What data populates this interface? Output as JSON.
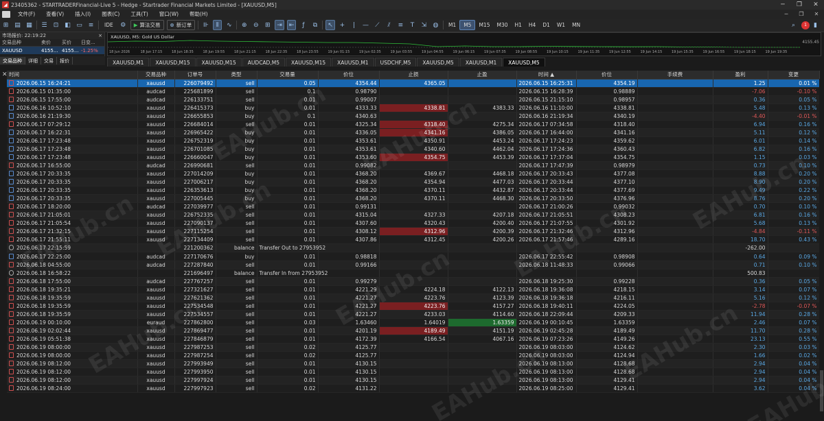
{
  "window": {
    "title": "23405362 - STARTRADERFinancial-Live 5 - Hedge - Startrader Financial Markets Limited - [XAUUSD,M5]",
    "minimize": "─",
    "restore": "❐",
    "close": "✕"
  },
  "menu": [
    "文件(F)",
    "查看(V)",
    "插入(I)",
    "图表(C)",
    "工具(T)",
    "窗口(W)",
    "帮助(H)"
  ],
  "menu_controls": [
    "─",
    "❐",
    "✕"
  ],
  "toolbar": {
    "algo_trading": "算法交易",
    "new_order": "新订单",
    "ide": "IDE",
    "timeframes": [
      "M1",
      "M5",
      "M15",
      "M30",
      "H1",
      "H4",
      "D1",
      "W1",
      "MN"
    ],
    "active_timeframe": "M5",
    "notification_count": "1"
  },
  "market_watch": {
    "title": "市场报价: 22:19:22",
    "close": "×",
    "cols": [
      "交易品种",
      "卖价",
      "买价",
      "日变..."
    ],
    "row": {
      "symbol": "XAUUSD",
      "bid": "4155...",
      "ask": "4155...",
      "change": "-1.25%"
    },
    "tabs": [
      "交易品种",
      "详细",
      "交易",
      "报价"
    ]
  },
  "chart": {
    "title": "XAUUSD, M5: Gold US Dollar",
    "price_label": "4155.45",
    "xaxis": [
      "18 Jun 2026",
      "18 Jun 17:15",
      "18 Jun 18:35",
      "18 Jun 19:55",
      "18 Jun 21:15",
      "18 Jun 22:35",
      "18 Jun 23:55",
      "19 Jun 01:15",
      "19 Jun 02:35",
      "19 Jun 03:55",
      "19 Jun 04:55",
      "19 Jun 06:15",
      "19 Jun 07:35",
      "19 Jun 08:55",
      "19 Jun 10:15",
      "19 Jun 11:35",
      "19 Jun 12:55",
      "19 Jun 14:15",
      "19 Jun 15:35",
      "19 Jun 16:55",
      "19 Jun 18:15",
      "19 Jun 19:35"
    ]
  },
  "chart_tabs": [
    "XAUUSD,M1",
    "XAUUSD,M15",
    "XAUUSD,M15",
    "AUDCAD,M5",
    "XAUUSD,M15",
    "XAUUSD,M1",
    "USDCHF,M5",
    "XAUUSD,M5",
    "XAUUSD,M1",
    "XAUUSD,M5"
  ],
  "active_chart_tab": 9,
  "watermark": "EAHub.cn",
  "columns": [
    "时间",
    "交易品种",
    "订单号",
    "类型",
    "交易量",
    "价位",
    "止损",
    "止盈",
    "时间 ▲",
    "价位",
    "手续费",
    "盈利",
    "变更"
  ],
  "rows": [
    {
      "t": "2026.06.15 16:24:21",
      "s": "xauusd",
      "id": "226079492",
      "ty": "sell",
      "v": "0.05",
      "p": "4354.44",
      "sl": "4365.05",
      "tp": "",
      "t2": "2026.06.15 16:25:31",
      "p2": "4354.19",
      "pr": "1.25",
      "ch": "0.01 %",
      "sel": true
    },
    {
      "t": "2026.06.15 01:35:00",
      "s": "audcad",
      "id": "225681899",
      "ty": "sell",
      "v": "0.1",
      "p": "0.98790",
      "sl": "",
      "tp": "",
      "t2": "2026.06.15 16:28:39",
      "p2": "0.98889",
      "pr": "-7.06",
      "ch": "-0.10 %"
    },
    {
      "t": "2026.06.15 17:55:00",
      "s": "audcad",
      "id": "226133751",
      "ty": "sell",
      "v": "0.01",
      "p": "0.99007",
      "sl": "",
      "tp": "",
      "t2": "2026.06.15 21:15:10",
      "p2": "0.98957",
      "pr": "0.36",
      "ch": "0.05 %"
    },
    {
      "t": "2026.06.16 10:52:10",
      "s": "xauusd",
      "id": "226415373",
      "ty": "buy",
      "v": "0.01",
      "p": "4333.33",
      "sl": "4338.81",
      "tp": "4383.33",
      "t2": "2026.06.16 11:10:00",
      "p2": "4338.81",
      "pr": "5.48",
      "ch": "0.13 %",
      "slHit": true
    },
    {
      "t": "2026.06.16 21:19:30",
      "s": "xauusd",
      "id": "226655853",
      "ty": "buy",
      "v": "0.1",
      "p": "4340.63",
      "sl": "",
      "tp": "",
      "t2": "2026.06.16 21:19:34",
      "p2": "4340.19",
      "pr": "-4.40",
      "ch": "-0.01 %"
    },
    {
      "t": "2026.06.17 07:29:12",
      "s": "xauusd",
      "id": "226684014",
      "ty": "sell",
      "v": "0.01",
      "p": "4325.34",
      "sl": "4318.40",
      "tp": "4275.34",
      "t2": "2026.06.17 07:34:58",
      "p2": "4318.40",
      "pr": "6.94",
      "ch": "0.16 %",
      "slHit": true
    },
    {
      "t": "2026.06.17 16:22:31",
      "s": "xauusd",
      "id": "226965422",
      "ty": "buy",
      "v": "0.01",
      "p": "4336.05",
      "sl": "4341.16",
      "tp": "4386.05",
      "t2": "2026.06.17 16:44:00",
      "p2": "4341.16",
      "pr": "5.11",
      "ch": "0.12 %",
      "slHit": true
    },
    {
      "t": "2026.06.17 17:23:48",
      "s": "xauusd",
      "id": "226752319",
      "ty": "buy",
      "v": "0.01",
      "p": "4353.61",
      "sl": "4350.91",
      "tp": "4453.24",
      "t2": "2026.06.17 17:24:23",
      "p2": "4359.62",
      "pr": "6.01",
      "ch": "0.14 %"
    },
    {
      "t": "2026.06.17 17:23:48",
      "s": "xauusd",
      "id": "226701085",
      "ty": "buy",
      "v": "0.01",
      "p": "4353.61",
      "sl": "4340.60",
      "tp": "4462.04",
      "t2": "2026.06.17 17:24:36",
      "p2": "4360.43",
      "pr": "6.82",
      "ch": "0.16 %"
    },
    {
      "t": "2026.06.17 17:23:48",
      "s": "xauusd",
      "id": "226660047",
      "ty": "buy",
      "v": "0.01",
      "p": "4353.60",
      "sl": "4354.75",
      "tp": "4453.39",
      "t2": "2026.06.17 17:37:04",
      "p2": "4354.75",
      "pr": "1.15",
      "ch": "0.03 %",
      "slHit": true
    },
    {
      "t": "2026.06.17 16:55:00",
      "s": "audcad",
      "id": "226990681",
      "ty": "sell",
      "v": "0.01",
      "p": "0.99082",
      "sl": "",
      "tp": "",
      "t2": "2026.06.17 17:47:39",
      "p2": "0.98979",
      "pr": "0.73",
      "ch": "0.10 %"
    },
    {
      "t": "2026.06.17 20:33:35",
      "s": "xauusd",
      "id": "227014209",
      "ty": "buy",
      "v": "0.01",
      "p": "4368.20",
      "sl": "4369.67",
      "tp": "4468.18",
      "t2": "2026.06.17 20:33:43",
      "p2": "4377.08",
      "pr": "8.88",
      "ch": "0.20 %"
    },
    {
      "t": "2026.06.17 20:33:35",
      "s": "xauusd",
      "id": "227006217",
      "ty": "buy",
      "v": "0.01",
      "p": "4368.20",
      "sl": "4354.94",
      "tp": "4477.03",
      "t2": "2026.06.17 20:33:44",
      "p2": "4377.10",
      "pr": "8.90",
      "ch": "0.20 %"
    },
    {
      "t": "2026.06.17 20:33:35",
      "s": "xauusd",
      "id": "226353613",
      "ty": "buy",
      "v": "0.01",
      "p": "4368.20",
      "sl": "4370.11",
      "tp": "4432.87",
      "t2": "2026.06.17 20:33:44",
      "p2": "4377.69",
      "pr": "9.49",
      "ch": "0.22 %"
    },
    {
      "t": "2026.06.17 20:33:35",
      "s": "xauusd",
      "id": "227005445",
      "ty": "buy",
      "v": "0.01",
      "p": "4368.20",
      "sl": "4370.11",
      "tp": "4468.30",
      "t2": "2026.06.17 20:33:50",
      "p2": "4376.96",
      "pr": "8.76",
      "ch": "0.20 %"
    },
    {
      "t": "2026.06.17 18:20:00",
      "s": "audcad",
      "id": "227039977",
      "ty": "sell",
      "v": "0.01",
      "p": "0.99131",
      "sl": "",
      "tp": "",
      "t2": "2026.06.17 21:00:26",
      "p2": "0.99032",
      "pr": "0.70",
      "ch": "0.10 %"
    },
    {
      "t": "2026.06.17 21:05:01",
      "s": "xauusd",
      "id": "226752335",
      "ty": "sell",
      "v": "0.01",
      "p": "4315.04",
      "sl": "4327.33",
      "tp": "4207.18",
      "t2": "2026.06.17 21:05:51",
      "p2": "4308.23",
      "pr": "6.81",
      "ch": "0.16 %"
    },
    {
      "t": "2026.06.17 21:05:54",
      "s": "xauusd",
      "id": "227090137",
      "ty": "sell",
      "v": "0.01",
      "p": "4307.60",
      "sl": "4320.43",
      "tp": "4200.40",
      "t2": "2026.06.17 21:07:55",
      "p2": "4301.92",
      "pr": "5.68",
      "ch": "0.13 %"
    },
    {
      "t": "2026.06.17 21:32:15",
      "s": "xauusd",
      "id": "227115254",
      "ty": "sell",
      "v": "0.01",
      "p": "4308.12",
      "sl": "4312.96",
      "tp": "4200.39",
      "t2": "2026.06.17 21:32:46",
      "p2": "4312.96",
      "pr": "-4.84",
      "ch": "-0.11 %",
      "slHit": true
    },
    {
      "t": "2026.06.17 21:55:11",
      "s": "xauusd",
      "id": "227134409",
      "ty": "sell",
      "v": "0.01",
      "p": "4307.86",
      "sl": "4312.45",
      "tp": "4200.26",
      "t2": "2026.06.17 21:57:46",
      "p2": "4289.16",
      "pr": "18.70",
      "ch": "0.43 %"
    },
    {
      "t": "2026.06.17 22:15:59",
      "s": "",
      "id": "221200362",
      "ty": "balance",
      "v": "Transfer Out to 27953952",
      "p": "",
      "sl": "",
      "tp": "",
      "t2": "",
      "p2": "",
      "pr": "-262.00",
      "ch": "",
      "bal": true
    },
    {
      "t": "2026.06.17 22:25:00",
      "s": "audcad",
      "id": "227170676",
      "ty": "buy",
      "v": "0.01",
      "p": "0.98818",
      "sl": "",
      "tp": "",
      "t2": "2026.06.17 22:55:42",
      "p2": "0.98908",
      "pr": "0.64",
      "ch": "0.09 %"
    },
    {
      "t": "2026.06.18 04:55:00",
      "s": "audcad",
      "id": "227287840",
      "ty": "sell",
      "v": "0.01",
      "p": "0.99166",
      "sl": "",
      "tp": "",
      "t2": "2026.06.18 11:48:33",
      "p2": "0.99066",
      "pr": "0.71",
      "ch": "0.10 %"
    },
    {
      "t": "2026.06.18 16:58:22",
      "s": "",
      "id": "221696497",
      "ty": "balance",
      "v": "Transfer In from 27953952",
      "p": "",
      "sl": "",
      "tp": "",
      "t2": "",
      "p2": "",
      "pr": "500.83",
      "ch": "",
      "bal": true
    },
    {
      "t": "2026.06.18 17:55:00",
      "s": "audcad",
      "id": "227767257",
      "ty": "sell",
      "v": "0.01",
      "p": "0.99279",
      "sl": "",
      "tp": "",
      "t2": "2026.06.18 19:25:30",
      "p2": "0.99228",
      "pr": "0.36",
      "ch": "0.05 %"
    },
    {
      "t": "2026.06.18 19:35:21",
      "s": "xauusd",
      "id": "227321627",
      "ty": "sell",
      "v": "0.01",
      "p": "4221.29",
      "sl": "4224.18",
      "tp": "4122.13",
      "t2": "2026.06.18 19:36:08",
      "p2": "4218.15",
      "pr": "3.14",
      "ch": "0.07 %"
    },
    {
      "t": "2026.06.18 19:35:59",
      "s": "xauusd",
      "id": "227621362",
      "ty": "sell",
      "v": "0.01",
      "p": "4221.27",
      "sl": "4223.76",
      "tp": "4123.39",
      "t2": "2026.06.18 19:36:18",
      "p2": "4216.11",
      "pr": "5.16",
      "ch": "0.12 %"
    },
    {
      "t": "2026.06.18 19:35:59",
      "s": "xauusd",
      "id": "227534548",
      "ty": "sell",
      "v": "0.01",
      "p": "4221.27",
      "sl": "4223.76",
      "tp": "4157.27",
      "t2": "2026.06.18 19:40:11",
      "p2": "4224.05",
      "pr": "-2.78",
      "ch": "-0.07 %",
      "slHit": true
    },
    {
      "t": "2026.06.18 19:35:59",
      "s": "xauusd",
      "id": "227534557",
      "ty": "sell",
      "v": "0.01",
      "p": "4221.27",
      "sl": "4233.03",
      "tp": "4114.60",
      "t2": "2026.06.18 22:09:44",
      "p2": "4209.33",
      "pr": "11.94",
      "ch": "0.28 %"
    },
    {
      "t": "2026.06.19 00:10:00",
      "s": "euraud",
      "id": "227862800",
      "ty": "sell",
      "v": "0.03",
      "p": "1.63460",
      "sl": "1.64019",
      "tp": "1.63359",
      "t2": "2026.06.19 00:10:45",
      "p2": "1.63359",
      "pr": "2.46",
      "ch": "0.07 %",
      "tpHit": true
    },
    {
      "t": "2026.06.19 02:02:44",
      "s": "xauusd",
      "id": "227869477",
      "ty": "sell",
      "v": "0.01",
      "p": "4201.19",
      "sl": "4189.49",
      "tp": "4151.19",
      "t2": "2026.06.19 02:45:28",
      "p2": "4189.49",
      "pr": "11.70",
      "ch": "0.28 %",
      "slHit": true
    },
    {
      "t": "2026.06.19 05:51:38",
      "s": "xauusd",
      "id": "227846879",
      "ty": "sell",
      "v": "0.01",
      "p": "4172.39",
      "sl": "4166.54",
      "tp": "4067.16",
      "t2": "2026.06.19 07:23:26",
      "p2": "4149.26",
      "pr": "23.13",
      "ch": "0.55 %"
    },
    {
      "t": "2026.06.19 08:00:00",
      "s": "xauusd",
      "id": "227987253",
      "ty": "sell",
      "v": "0.02",
      "p": "4125.77",
      "sl": "",
      "tp": "",
      "t2": "2026.06.19 08:03:00",
      "p2": "4124.62",
      "pr": "2.30",
      "ch": "0.03 %"
    },
    {
      "t": "2026.06.19 08:00:00",
      "s": "xauusd",
      "id": "227987254",
      "ty": "sell",
      "v": "0.02",
      "p": "4125.77",
      "sl": "",
      "tp": "",
      "t2": "2026.06.19 08:03:00",
      "p2": "4124.94",
      "pr": "1.66",
      "ch": "0.02 %"
    },
    {
      "t": "2026.06.19 08:12:00",
      "s": "xauusd",
      "id": "227993949",
      "ty": "sell",
      "v": "0.01",
      "p": "4130.15",
      "sl": "",
      "tp": "",
      "t2": "2026.06.19 08:13:00",
      "p2": "4128.68",
      "pr": "2.94",
      "ch": "0.04 %"
    },
    {
      "t": "2026.06.19 08:12:00",
      "s": "xauusd",
      "id": "227993950",
      "ty": "sell",
      "v": "0.01",
      "p": "4130.15",
      "sl": "",
      "tp": "",
      "t2": "2026.06.19 08:13:00",
      "p2": "4128.68",
      "pr": "2.94",
      "ch": "0.04 %"
    },
    {
      "t": "2026.06.19 08:12:00",
      "s": "xauusd",
      "id": "227997924",
      "ty": "sell",
      "v": "0.01",
      "p": "4130.15",
      "sl": "",
      "tp": "",
      "t2": "2026.06.19 08:13:00",
      "p2": "4129.41",
      "pr": "2.94",
      "ch": "0.04 %"
    },
    {
      "t": "2026.06.19 08:24:00",
      "s": "xauusd",
      "id": "227997923",
      "ty": "sell",
      "v": "0.02",
      "p": "4131.22",
      "sl": "",
      "tp": "",
      "t2": "2026.06.19 08:25:00",
      "p2": "4129.41",
      "pr": "3.62",
      "ch": "0.04 %"
    }
  ]
}
